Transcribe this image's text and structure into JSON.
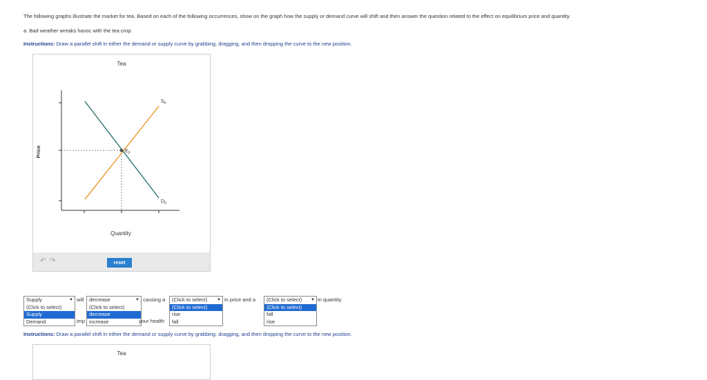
{
  "question": {
    "text": "The following graphs illustrate the market for tea. Based on each of the following occurrences, show on the graph how the supply or demand curve will shift and then answer the question related to the effect on equilibrium price and quantity.",
    "part_a": "a. Bad weather wreaks havoc with the tea crop."
  },
  "instructions": {
    "prefix": "Instructions:",
    "text": " Draw a parallel shift in either the demand or supply curve by grabbing, dragging, and then dropping the curve to the new position."
  },
  "graph": {
    "title": "Tea",
    "xlabel": "Quantity",
    "ylabel": "Price",
    "supply_label": "S",
    "supply_sub": "0",
    "demand_label": "D",
    "demand_sub": "0",
    "eq_label": "E",
    "eq_sub": "0",
    "colors": {
      "supply": "#e8901e",
      "demand": "#1f6b6b",
      "axis": "#333333"
    }
  },
  "toolbar": {
    "undo_icon": "undo-icon",
    "redo_icon": "redo-icon",
    "reset_label": "reset"
  },
  "answer": {
    "curve_dropdown": {
      "selected": "Supply",
      "options": [
        "(Click to select)",
        "Supply",
        "Demand"
      ],
      "highlighted": "Supply"
    },
    "will_text": "will",
    "shift_dropdown": {
      "selected": "decrease",
      "options": [
        "(Click to select)",
        "decrease",
        "increase"
      ],
      "highlighted": "decrease"
    },
    "causing_text": ", causing a",
    "price_dropdown": {
      "selected": "(Click to select)",
      "options": [
        "(Click to select)",
        "rise",
        "fall"
      ],
      "highlighted": "(Click to select)"
    },
    "in_price_text": "in price and a",
    "quantity_dropdown": {
      "selected": "(Click to select)",
      "options": [
        "(Click to select)",
        "fall",
        "rise"
      ],
      "highlighted": "(Click to select)"
    },
    "in_quantity_text": "in quantity.",
    "partial_imp": "imp",
    "partial_health": "your health"
  },
  "graph2": {
    "title": "Tea"
  }
}
